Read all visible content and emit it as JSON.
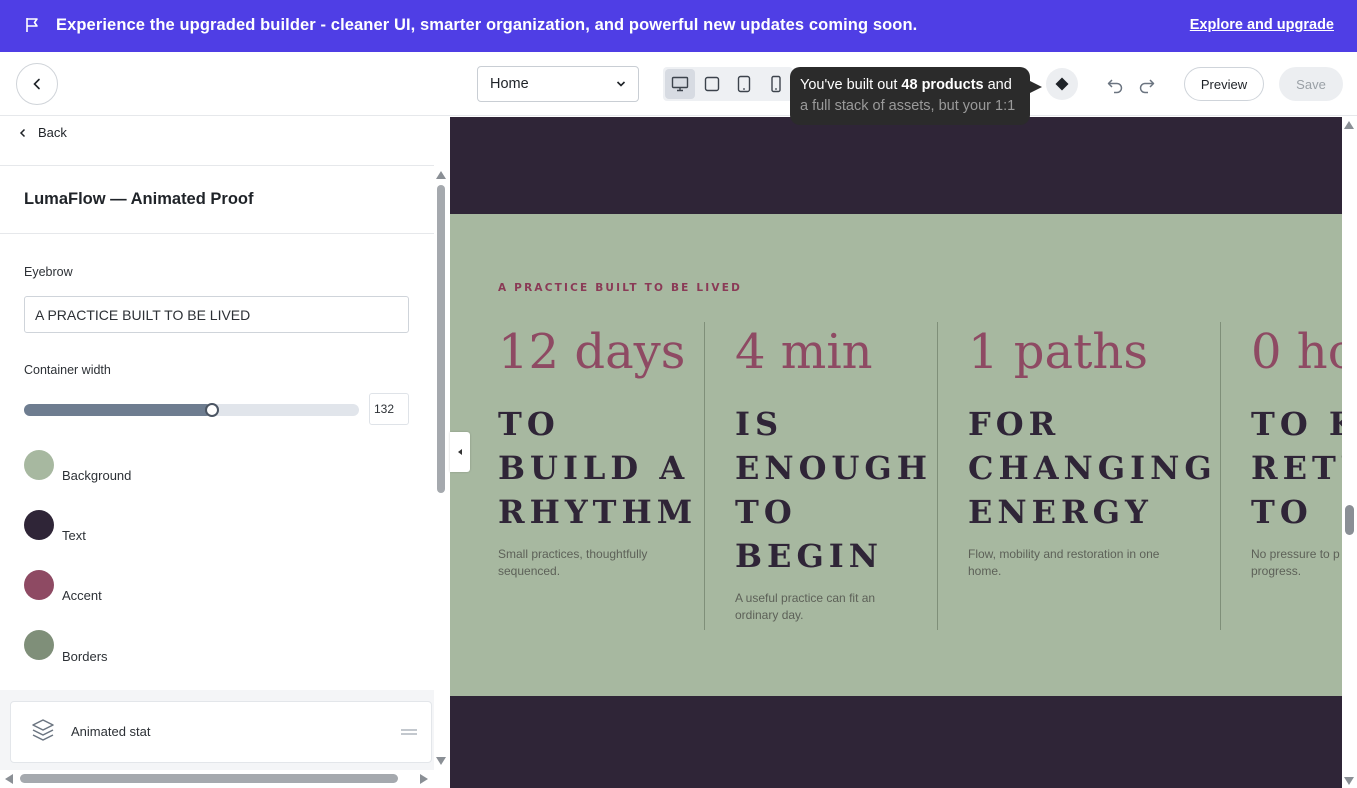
{
  "banner": {
    "message": "Experience the upgraded builder - cleaner UI, smarter organization, and powerful new updates coming soon.",
    "link": "Explore and upgrade",
    "icon": "flag-icon",
    "color": "#4f3ee5"
  },
  "toolbar": {
    "page_select": "Home",
    "devices": [
      "desktop-icon",
      "laptop-icon",
      "tablet-icon",
      "mobile-icon"
    ],
    "tooltip_line1_prefix": "You've built out ",
    "tooltip_line1_bold": "48 products",
    "tooltip_line1_suffix": " and",
    "tooltip_line2": "a full stack of assets, but your 1:1",
    "preview": "Preview",
    "save": "Save"
  },
  "panel": {
    "back": "Back",
    "title": "LumaFlow — Animated Proof",
    "eyebrow_label": "Eyebrow",
    "eyebrow_value": "A PRACTICE BUILT TO BE LIVED",
    "container_width_label": "Container width",
    "container_width_value": "132",
    "container_width_fraction": 0.56,
    "colors": [
      {
        "label": "Background",
        "hex": "#a7b8a0"
      },
      {
        "label": "Text",
        "hex": "#2f2537"
      },
      {
        "label": "Accent",
        "hex": "#8e4a63"
      },
      {
        "label": "Borders",
        "hex": "#7f8f79"
      }
    ],
    "block_label": "Animated stat"
  },
  "preview": {
    "eyebrow": "A PRACTICE BUILT TO BE LIVED",
    "stats": [
      {
        "number": "12 days",
        "heading": "TO\nBUILD A\nRHYTHM",
        "desc": "Small practices, thoughtfully sequenced."
      },
      {
        "number": "4 min",
        "heading": "IS\nENOUGH\nTO\nBEGIN",
        "desc": "A useful practice can fit an ordinary day."
      },
      {
        "number": "1 paths",
        "heading": "FOR\nCHANGING\nENERGY",
        "desc": "Flow, mobility and restoration in one home."
      },
      {
        "number": "0 ho",
        "heading": "TO K\nRETU\nTO",
        "desc": "No pressure to p progress."
      }
    ]
  }
}
